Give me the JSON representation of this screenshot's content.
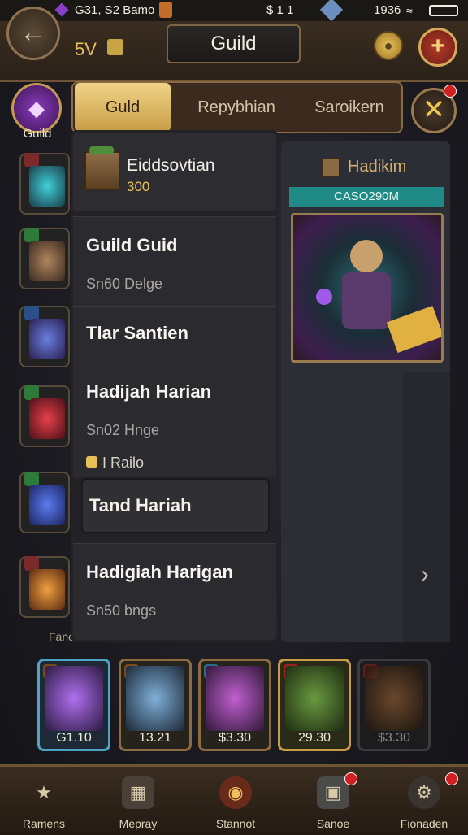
{
  "status_bar": {
    "left_text": "G31, S2 Bamo",
    "center_text": "$ 1 1",
    "right_text": "1936"
  },
  "header": {
    "level": "5V",
    "title": "Guild",
    "add_label": "+",
    "back_label": "←"
  },
  "left_rail": {
    "guild_label": "Guild",
    "edge_label": "Fanc"
  },
  "tabs": [
    "Guld",
    "Repybhian",
    "Saroikern"
  ],
  "close_label": "✕",
  "profile": {
    "name": "Eiddsovtian",
    "score": "300"
  },
  "list": [
    {
      "title": "Guild Guid",
      "sub": "Sn60 Delge"
    },
    {
      "title": "Tlar Santien"
    },
    {
      "title": "Hadijah Harian",
      "sub": "Sn02 Hnge",
      "tag": "I Railo"
    },
    {
      "title": "Tand Hariah",
      "selected": true
    },
    {
      "title": "Hadigiah Harigan",
      "sub": "Sn50 bngs"
    }
  ],
  "right_panel": {
    "title": "Hadikim",
    "teal_label": "CASO290M",
    "arrow": "›"
  },
  "cards": [
    {
      "price": "G1.10",
      "border": "#4fa3c7"
    },
    {
      "price": "13.21",
      "border": "#8b6b3f"
    },
    {
      "price": "$3.30",
      "border": "#8b6b3f"
    },
    {
      "price": "29.30",
      "border": "#c79c45"
    },
    {
      "price": "$3.30",
      "border": "#3b3b3b"
    }
  ],
  "bottom_nav": [
    {
      "label": "Ramens",
      "icon": "star-icon"
    },
    {
      "label": "Mepray",
      "icon": "box-icon"
    },
    {
      "label": "Stannot",
      "icon": "shield-icon"
    },
    {
      "label": "Sanoe",
      "icon": "screen-icon"
    },
    {
      "label": "Fionaden",
      "icon": "gear-icon"
    }
  ],
  "colors": {
    "accent_gold": "#e8c15a",
    "teal": "#1f8a86",
    "badge_red": "#d02020"
  }
}
